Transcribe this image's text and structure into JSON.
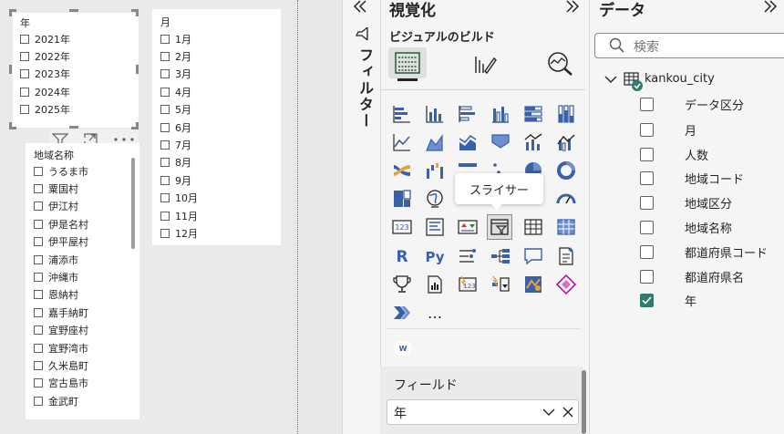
{
  "canvas": {
    "year_slicer": {
      "title": "年",
      "items": [
        "2021年",
        "2022年",
        "2023年",
        "2024年",
        "2025年"
      ]
    },
    "month_slicer": {
      "title": "月",
      "items": [
        "1月",
        "2月",
        "3月",
        "4月",
        "5月",
        "6月",
        "7月",
        "8月",
        "9月",
        "10月",
        "11月",
        "12月"
      ]
    },
    "region_slicer": {
      "title": "地域名称",
      "items": [
        "うるま市",
        "粟国村",
        "伊江村",
        "伊是名村",
        "伊平屋村",
        "浦添市",
        "沖縄市",
        "恩納村",
        "嘉手納町",
        "宜野座村",
        "宜野湾市",
        "久米島町",
        "宮古島市",
        "金武町"
      ],
      "more_icon": "more-options-icon",
      "filter_icon": "filter-icon",
      "focus_icon": "focus-mode-icon"
    }
  },
  "filter_pane": {
    "label": "フィルター",
    "expand_icon": "chevron-double-left-icon",
    "filter_icon": "funnel-icon"
  },
  "visualizations": {
    "title": "視覚化",
    "subtitle": "ビジュアルのビルド",
    "collapse_icon": "chevron-double-right-icon",
    "tooltip": "スライサー",
    "more_label": "…",
    "custom_visual_badge": "W",
    "fields_label": "フィールド",
    "field_value": "年"
  },
  "data_pane": {
    "title": "データ",
    "collapse_icon": "chevron-double-right-icon",
    "search_placeholder": "検索",
    "table_name": "kankou_city",
    "fields": [
      {
        "label": "データ区分",
        "checked": false
      },
      {
        "label": "月",
        "checked": false
      },
      {
        "label": "人数",
        "checked": false
      },
      {
        "label": "地域コード",
        "checked": false
      },
      {
        "label": "地域区分",
        "checked": false
      },
      {
        "label": "地域名称",
        "checked": false
      },
      {
        "label": "都道府県コード",
        "checked": false
      },
      {
        "label": "都道府県名",
        "checked": false
      },
      {
        "label": "年",
        "checked": true
      }
    ]
  },
  "colors": {
    "accent": "#2e7d6e",
    "icon_blue": "#3a60a8",
    "icon_orange": "#e8a23a"
  }
}
